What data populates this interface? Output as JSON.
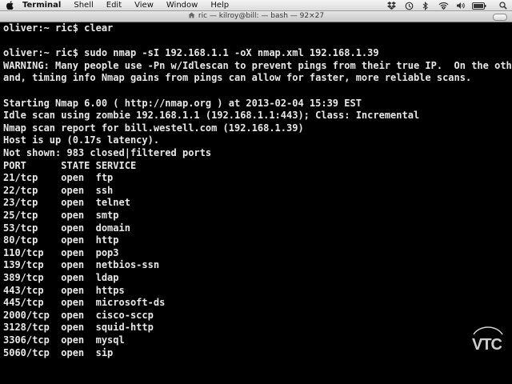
{
  "menubar": {
    "items": [
      "Terminal",
      "Shell",
      "Edit",
      "View",
      "Window",
      "Help"
    ]
  },
  "window": {
    "title": "ric — kilroy@bill: — bash — 92×27"
  },
  "terminal": {
    "lines": [
      "oliver:~ ric$ clear",
      "",
      "oliver:~ ric$ sudo nmap -sI 192.168.1.1 -oX nmap.xml 192.168.1.39",
      "WARNING: Many people use -Pn w/Idlescan to prevent pings from their true IP.  On the other h",
      "and, timing info Nmap gains from pings can allow for faster, more reliable scans.",
      "",
      "Starting Nmap 6.00 ( http://nmap.org ) at 2013-02-04 15:39 EST",
      "Idle scan using zombie 192.168.1.1 (192.168.1.1:443); Class: Incremental",
      "Nmap scan report for bill.westell.com (192.168.1.39)",
      "Host is up (0.17s latency).",
      "Not shown: 983 closed|filtered ports",
      "PORT      STATE SERVICE",
      "21/tcp    open  ftp",
      "22/tcp    open  ssh",
      "23/tcp    open  telnet",
      "25/tcp    open  smtp",
      "53/tcp    open  domain",
      "80/tcp    open  http",
      "110/tcp   open  pop3",
      "139/tcp   open  netbios-ssn",
      "389/tcp   open  ldap",
      "443/tcp   open  https",
      "445/tcp   open  microsoft-ds",
      "2000/tcp  open  cisco-sccp",
      "3128/tcp  open  squid-http",
      "3306/tcp  open  mysql",
      "5060/tcp  open  sip"
    ]
  },
  "watermark": {
    "text": "VTC"
  }
}
